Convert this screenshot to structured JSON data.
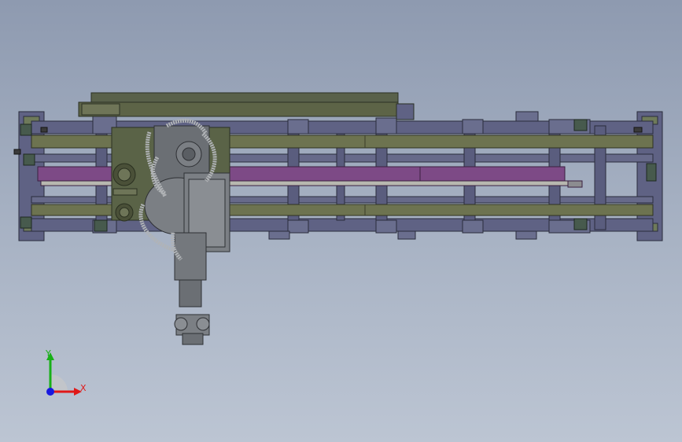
{
  "viewport": {
    "background_top": "#8e9ab0",
    "background_bottom": "#bcc5d3"
  },
  "model": {
    "frame_color": "#5f6284",
    "rail_color": "#6d7350",
    "slot_color": "#7d4a86",
    "carriage_color": "#5a6347",
    "robot_color": "#7b7f84",
    "bracket_color": "#475a4d"
  },
  "triad": {
    "x_label": "X",
    "y_label": "Y",
    "x_color": "#e01818",
    "y_color": "#18b018",
    "z_color": "#1818e0"
  }
}
